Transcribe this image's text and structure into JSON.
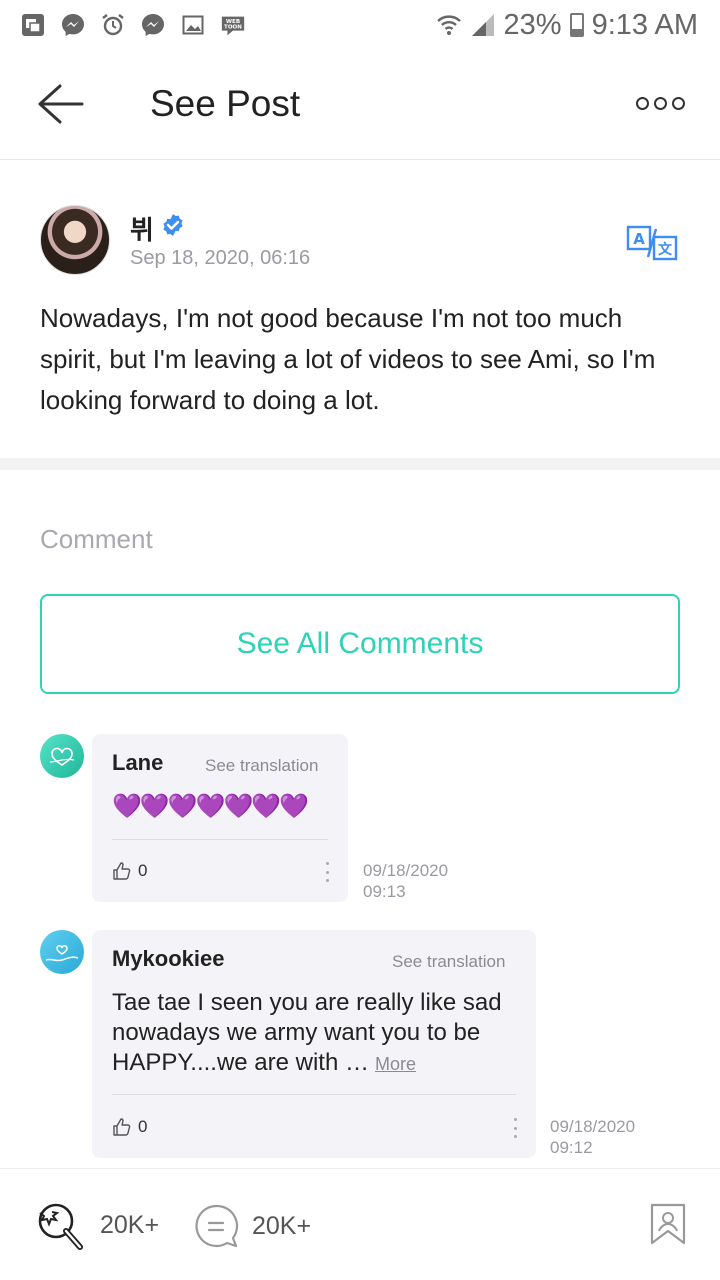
{
  "status_bar": {
    "battery_percent": "23%",
    "time": "9:13 AM"
  },
  "header": {
    "title": "See Post"
  },
  "post": {
    "author": "뷔",
    "date": "Sep 18, 2020, 06:16",
    "text": "Nowadays, I'm not good because I'm not too much spirit, but I'm leaving a lot of videos to see Ami, so I'm looking forward to doing a lot."
  },
  "comments_section": {
    "label": "Comment",
    "see_all_label": "See All Comments",
    "items": [
      {
        "name": "Lane",
        "translate_label": "See translation",
        "text": "💜💜💜💜💜💜💜",
        "likes": "0",
        "date": "09/18/2020",
        "time": "09:13"
      },
      {
        "name": "Mykookiee",
        "translate_label": "See translation",
        "text": "Tae tae I seen you are really like sad nowadays we army want you to be HAPPY....we are with …",
        "more_label": "More",
        "likes": "0",
        "date": "09/18/2020",
        "time": "09:12"
      }
    ]
  },
  "bottom_bar": {
    "like_count": "20K+",
    "comment_count": "20K+"
  },
  "colors": {
    "accent": "#2ed3b7",
    "verified": "#3c8ff0"
  }
}
